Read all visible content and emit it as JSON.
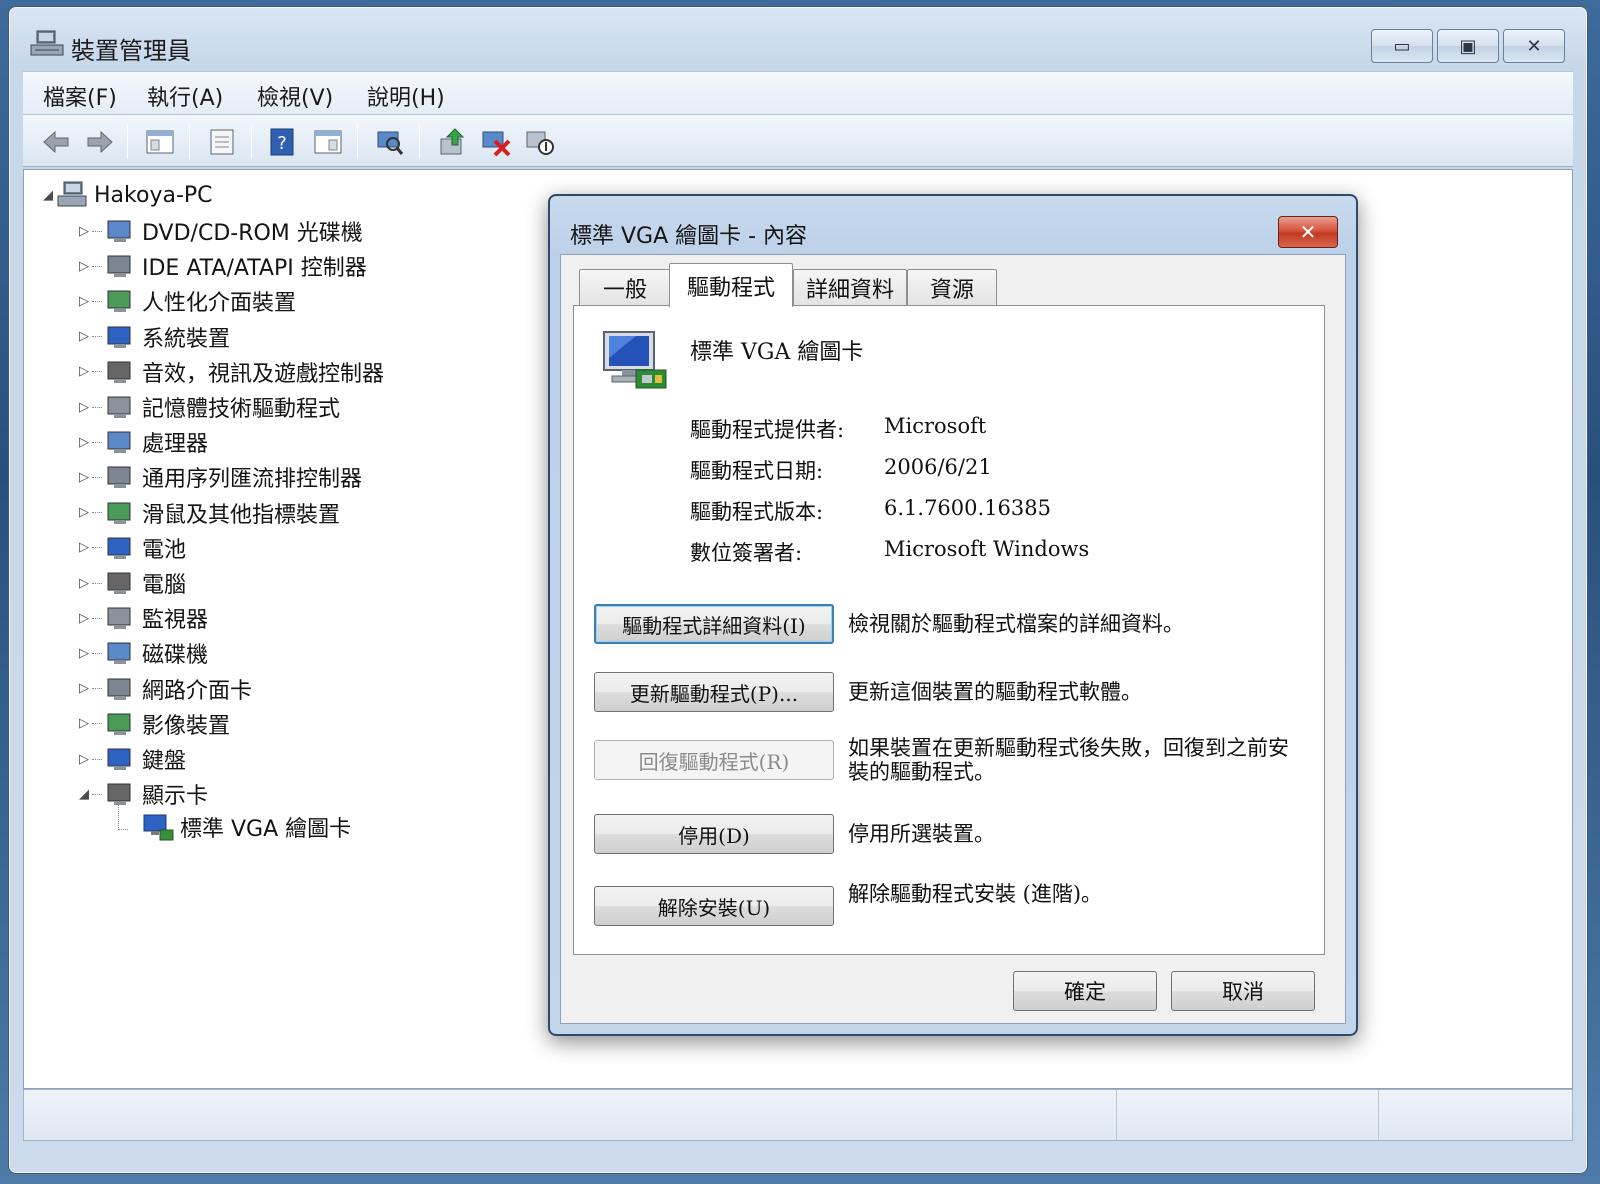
{
  "window": {
    "title": "裝置管理員",
    "icon": "device-manager-icon",
    "controls": {
      "minimize": "▭",
      "maximize": "▣",
      "close": "✕"
    }
  },
  "menu": [
    {
      "label": "檔案(F)"
    },
    {
      "label": "執行(A)"
    },
    {
      "label": "檢視(V)"
    },
    {
      "label": "說明(H)"
    }
  ],
  "toolbar": [
    {
      "icon": "back-arrow-icon"
    },
    {
      "icon": "forward-arrow-icon"
    },
    {
      "icon": "show-hide-console-tree-icon"
    },
    {
      "icon": "properties-icon"
    },
    {
      "icon": "help-icon"
    },
    {
      "icon": "show-hide-action-pane-icon"
    },
    {
      "icon": "scan-hardware-changes-icon"
    },
    {
      "icon": "update-driver-icon"
    },
    {
      "icon": "uninstall-device-icon"
    },
    {
      "icon": "disable-device-icon"
    }
  ],
  "tree": {
    "root": {
      "label": "Hakoya-PC",
      "icon": "computer-icon",
      "expander": "◢"
    },
    "categories": [
      {
        "label": "DVD/CD-ROM 光碟機",
        "icon": "dvd-drive-icon"
      },
      {
        "label": "IDE ATA/ATAPI 控制器",
        "icon": "ide-controller-icon"
      },
      {
        "label": "人性化介面裝置",
        "icon": "hid-icon"
      },
      {
        "label": "系統裝置",
        "icon": "system-devices-icon"
      },
      {
        "label": "音效，視訊及遊戲控制器",
        "icon": "speaker-icon"
      },
      {
        "label": "記憶體技術驅動程式",
        "icon": "memory-icon"
      },
      {
        "label": "處理器",
        "icon": "processor-icon"
      },
      {
        "label": "通用序列匯流排控制器",
        "icon": "usb-icon"
      },
      {
        "label": "滑鼠及其他指標裝置",
        "icon": "mouse-icon"
      },
      {
        "label": "電池",
        "icon": "battery-icon"
      },
      {
        "label": "電腦",
        "icon": "computer-monitor-icon"
      },
      {
        "label": "監視器",
        "icon": "monitor-icon"
      },
      {
        "label": "磁碟機",
        "icon": "disk-drive-icon"
      },
      {
        "label": "網路介面卡",
        "icon": "network-adapter-icon"
      },
      {
        "label": "影像裝置",
        "icon": "camera-icon"
      },
      {
        "label": "鍵盤",
        "icon": "keyboard-icon"
      },
      {
        "label": "顯示卡",
        "icon": "display-adapter-icon",
        "expanded": true
      }
    ],
    "child": {
      "label": "標準 VGA 繪圖卡",
      "icon": "vga-adapter-icon"
    },
    "collapsed_glyph": "▷",
    "expanded_glyph": "◢"
  },
  "dialog": {
    "title": "標準 VGA 繪圖卡 - 內容",
    "close": "✕",
    "tabs": [
      {
        "label": "一般"
      },
      {
        "label": "驅動程式",
        "active": true
      },
      {
        "label": "詳細資料"
      },
      {
        "label": "資源"
      }
    ],
    "device_name": "標準 VGA 繪圖卡",
    "info": [
      {
        "label": "驅動程式提供者:",
        "value": "Microsoft"
      },
      {
        "label": "驅動程式日期:",
        "value": "2006/6/21"
      },
      {
        "label": "驅動程式版本:",
        "value": "6.1.7600.16385"
      },
      {
        "label": "數位簽署者:",
        "value": "Microsoft Windows"
      }
    ],
    "actions": [
      {
        "button": "驅動程式詳細資料(I)",
        "desc": "檢視關於驅動程式檔案的詳細資料。",
        "state": "focused"
      },
      {
        "button": "更新驅動程式(P)...",
        "desc": "更新這個裝置的驅動程式軟體。",
        "state": "normal"
      },
      {
        "button": "回復驅動程式(R)",
        "desc": "如果裝置在更新驅動程式後失敗，回復到之前安裝的驅動程式。",
        "state": "disabled"
      },
      {
        "button": "停用(D)",
        "desc": "停用所選裝置。",
        "state": "normal"
      },
      {
        "button": "解除安裝(U)",
        "desc": "解除驅動程式安裝 (進階)。",
        "state": "normal"
      }
    ],
    "ok": "確定",
    "cancel": "取消"
  }
}
